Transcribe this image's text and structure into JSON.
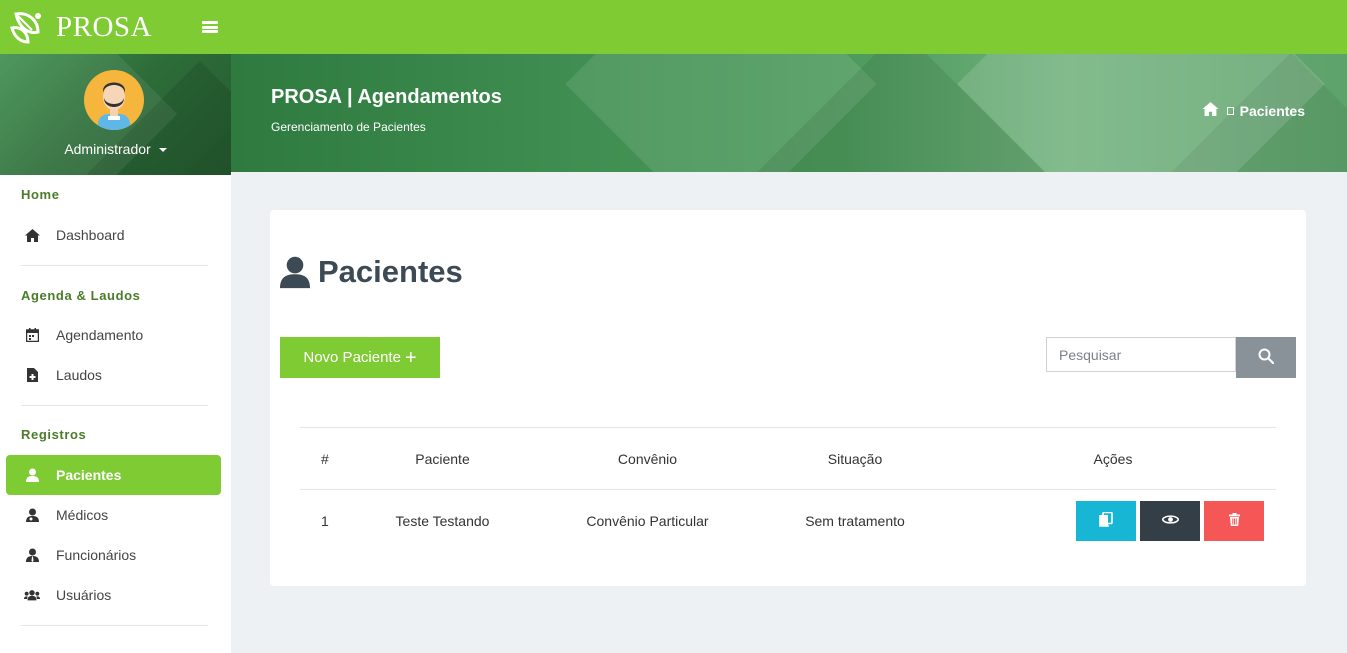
{
  "app": {
    "name": "PROSA"
  },
  "profile": {
    "name": "Administrador"
  },
  "sidebar": {
    "sections": [
      {
        "title": "Home",
        "items": [
          {
            "label": "Dashboard",
            "icon": "home-icon"
          }
        ]
      },
      {
        "title": "Agenda & Laudos",
        "items": [
          {
            "label": "Agendamento",
            "icon": "calendar-icon"
          },
          {
            "label": "Laudos",
            "icon": "file-medical-icon"
          }
        ]
      },
      {
        "title": "Registros",
        "items": [
          {
            "label": "Pacientes",
            "icon": "user-icon",
            "active": true
          },
          {
            "label": "Médicos",
            "icon": "doctor-icon"
          },
          {
            "label": "Funcionários",
            "icon": "user-tie-icon"
          },
          {
            "label": "Usuários",
            "icon": "users-icon"
          }
        ]
      }
    ]
  },
  "header": {
    "title": "PROSA | Agendamentos",
    "subtitle": "Gerenciamento de Pacientes",
    "breadcrumb": "Pacientes"
  },
  "page": {
    "title": "Pacientes",
    "new_button": "Novo Paciente",
    "new_button_icon": "+",
    "search_placeholder": "Pesquisar"
  },
  "table": {
    "headers": [
      "#",
      "Paciente",
      "Convênio",
      "Situação",
      "Ações"
    ],
    "rows": [
      {
        "id": "1",
        "paciente": "Teste Testando",
        "convenio": "Convênio Particular",
        "situacao": "Sem tratamento"
      }
    ]
  },
  "colors": {
    "brand": "#7ecb34",
    "info": "#17b6d4",
    "dark": "#343e46",
    "danger": "#f55656"
  }
}
